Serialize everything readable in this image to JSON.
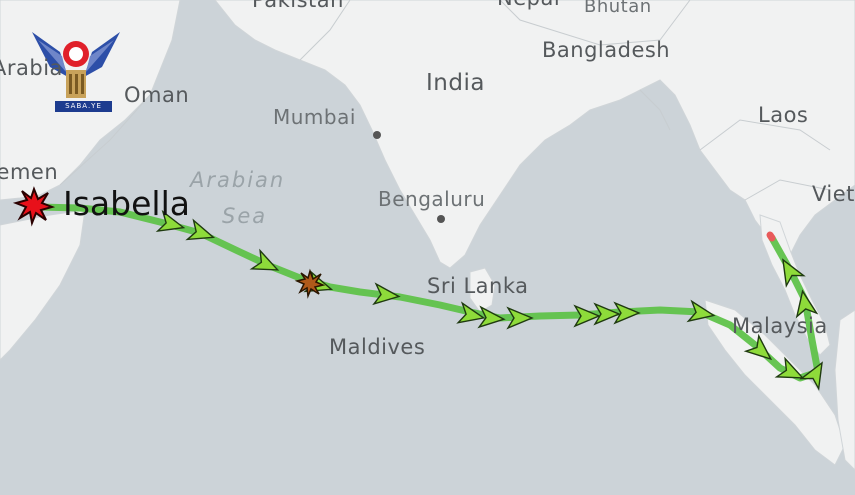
{
  "labels": {
    "pakistan": "Pakistan",
    "nepal": "Nepal",
    "bhutan": "Bhutan",
    "bangladesh": "Bangladesh",
    "arabia": "Arabia",
    "oman": "Oman",
    "india": "India",
    "mumbai": "Mumbai",
    "laos": "Laos",
    "yemen": "Yemen",
    "arabian_sea_1": "Arabian",
    "arabian_sea_2": "Sea",
    "bengaluru": "Bengaluru",
    "vietnam": "Vietnam",
    "sri_lanka": "Sri Lanka",
    "maldives": "Maldives",
    "malaysia": "Malaysia"
  },
  "vessel": {
    "name": "Isabella"
  },
  "logo": {
    "caption": "SABA.YE"
  },
  "colors": {
    "sea": "#ccd3d8",
    "land": "#f1f2f2",
    "route_line": "#5fc24a",
    "arrow_fill": "#8edb3a",
    "incident": "#e8101a"
  }
}
